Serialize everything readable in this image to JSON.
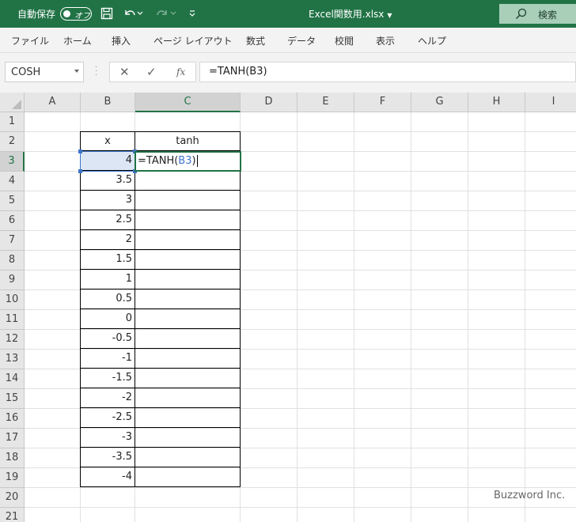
{
  "title_bar": {
    "autosave_label": "自動保存",
    "toggle_state": "オフ",
    "file_name": "Excel関数用.xlsx",
    "search_label": "検索",
    "colors": {
      "bar": "#217346",
      "search_bg": "#a9cfb9"
    }
  },
  "ribbon": {
    "tabs": [
      "ファイル",
      "ホーム",
      "挿入",
      "ページ レイアウト",
      "数式",
      "データ",
      "校閲",
      "表示",
      "ヘルプ"
    ]
  },
  "formula_bar": {
    "name_box": "COSH",
    "fx_label": "fx",
    "formula": "=TANH(B3)"
  },
  "grid": {
    "columns": [
      "A",
      "B",
      "C",
      "D",
      "E",
      "F",
      "G",
      "H",
      "I"
    ],
    "rows": [
      "1",
      "2",
      "3",
      "4",
      "5",
      "6",
      "7",
      "8",
      "9",
      "10",
      "11",
      "12",
      "13",
      "14",
      "15",
      "16",
      "17",
      "18",
      "19",
      "20",
      "21"
    ],
    "selected_column": "C",
    "selected_row": "3"
  },
  "table": {
    "header_x": "x",
    "header_tanh": "tanh",
    "x_values": [
      "4",
      "3.5",
      "3",
      "2.5",
      "2",
      "1.5",
      "1",
      "0.5",
      "0",
      "-0.5",
      "-1",
      "-1.5",
      "-2",
      "-2.5",
      "-3",
      "-3.5",
      "-4"
    ]
  },
  "edit_cell": {
    "prefix": "=TANH(",
    "ref": "B3",
    "suffix": ")"
  },
  "watermark": "Buzzword Inc."
}
